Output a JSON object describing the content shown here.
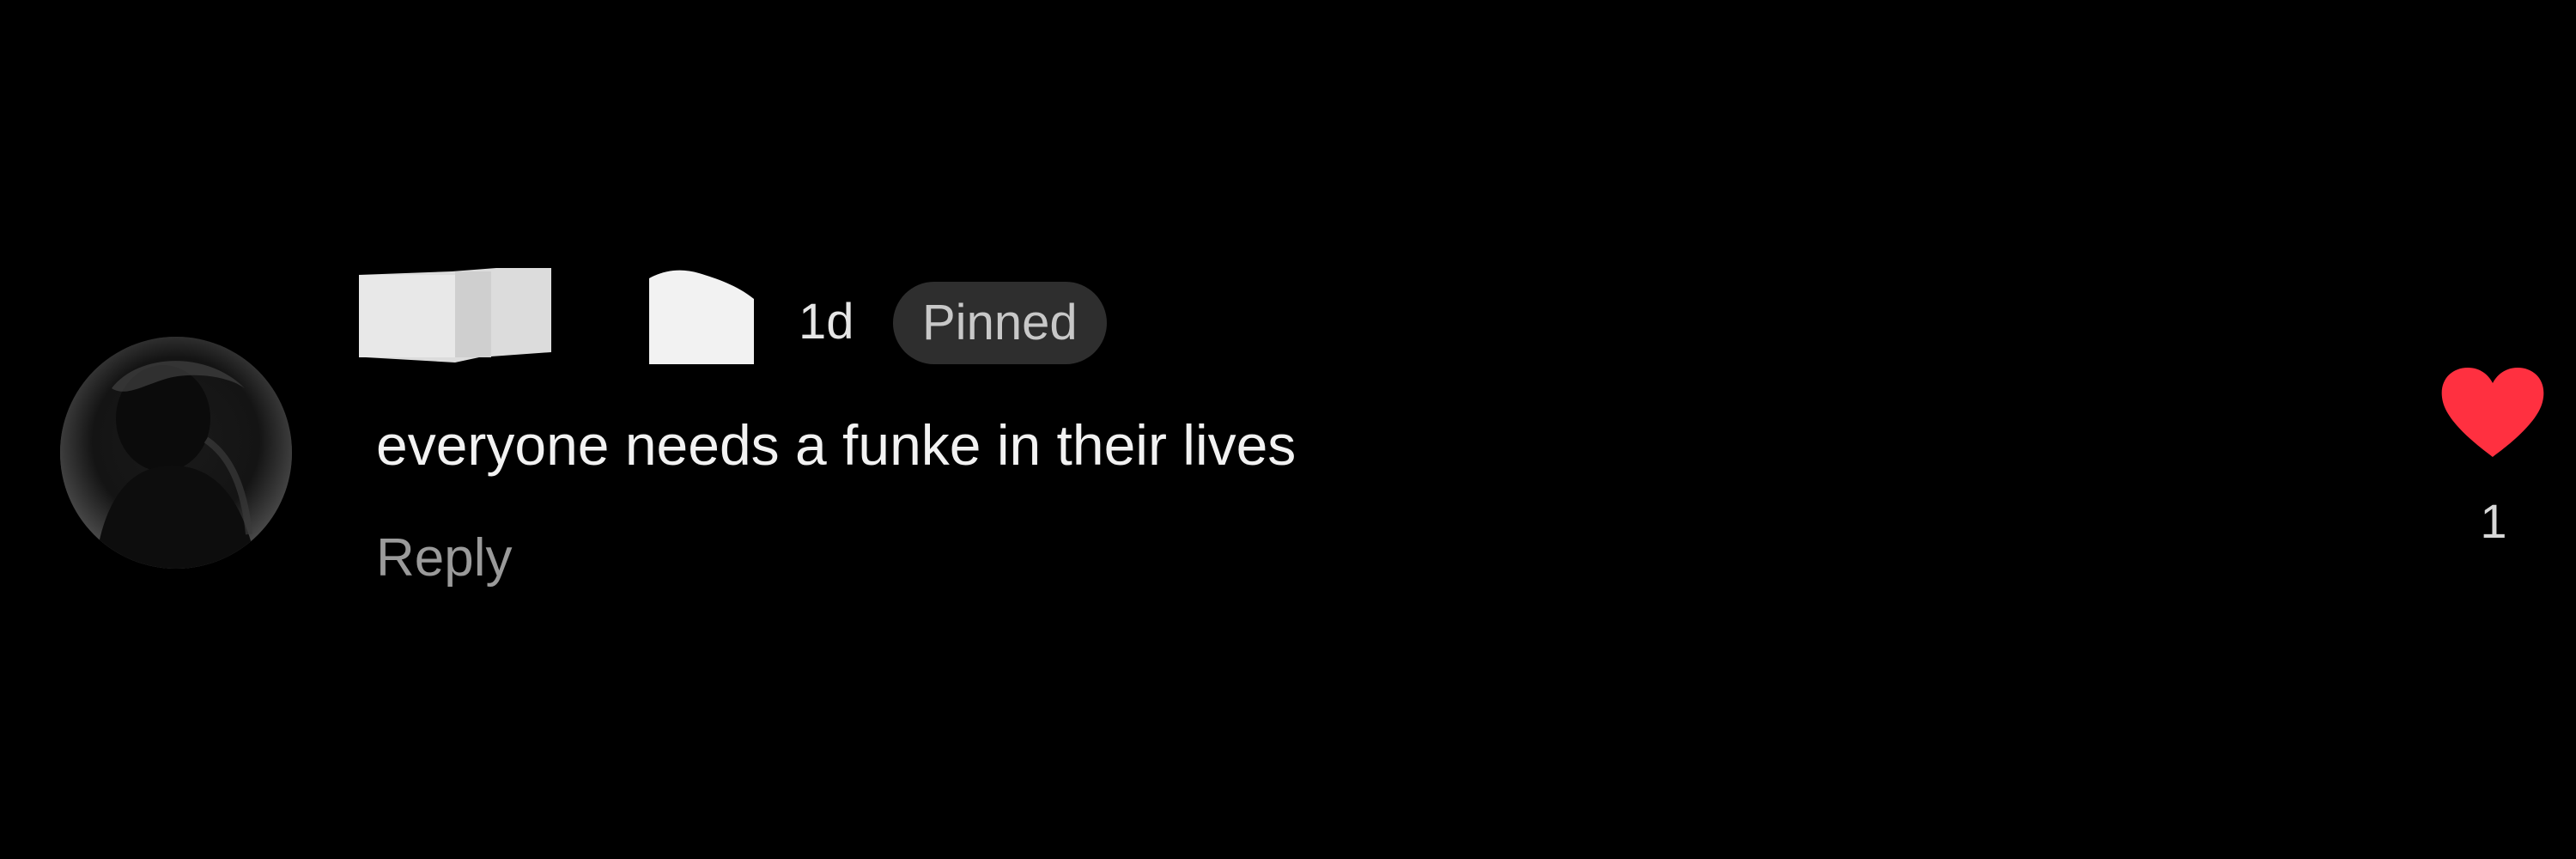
{
  "comment": {
    "timestamp": "1d",
    "pinned_label": "Pinned",
    "text": "everyone needs a funke in their lives",
    "reply_label": "Reply",
    "like_count": "1",
    "liked": true
  },
  "icons": {
    "like": "heart-icon",
    "avatar": "user-avatar"
  },
  "colors": {
    "background": "#000000",
    "heart": "#ff3040",
    "pinned_badge_bg": "#2e2e2e",
    "reply_text": "#9a9a9a"
  }
}
